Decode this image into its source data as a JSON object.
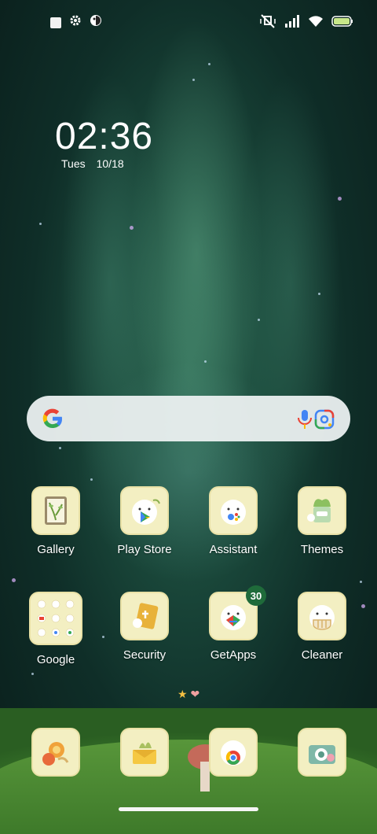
{
  "clock": {
    "time": "02:36",
    "day": "Tues",
    "date": "10/18"
  },
  "apps_row1": [
    {
      "label": "Gallery",
      "icon": "gallery-icon"
    },
    {
      "label": "Play Store",
      "icon": "play-store-icon"
    },
    {
      "label": "Assistant",
      "icon": "assistant-icon"
    },
    {
      "label": "Themes",
      "icon": "themes-icon"
    }
  ],
  "apps_row2": [
    {
      "label": "Google",
      "icon": "google-folder-icon"
    },
    {
      "label": "Security",
      "icon": "security-icon"
    },
    {
      "label": "GetApps",
      "icon": "getapps-icon",
      "badge": "30"
    },
    {
      "label": "Cleaner",
      "icon": "cleaner-icon"
    }
  ],
  "dock": [
    {
      "icon": "phone-icon"
    },
    {
      "icon": "messages-icon"
    },
    {
      "icon": "chrome-icon"
    },
    {
      "icon": "camera-icon"
    }
  ],
  "colors": {
    "badge": "#1f6b3a",
    "icon_bg": "#f3efc2",
    "search_bg": "#ebf0f0"
  }
}
